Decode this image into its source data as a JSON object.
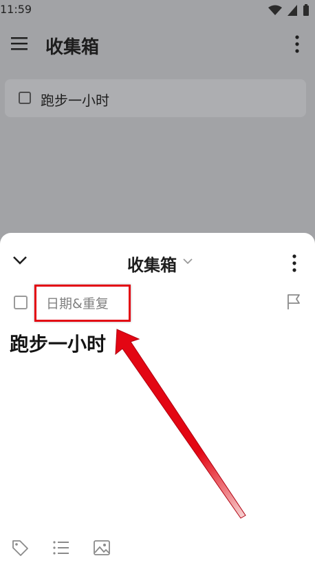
{
  "status_bar": {
    "time": "11:59"
  },
  "app_bar": {
    "title": "收集箱"
  },
  "list": {
    "items": [
      {
        "label": "跑步一小时"
      }
    ]
  },
  "sheet": {
    "title": "收集箱",
    "date_repeat_label": "日期&重复",
    "task_title": "跑步一小时"
  },
  "colors": {
    "highlight": "#e30613",
    "arrow": "#e30613"
  }
}
